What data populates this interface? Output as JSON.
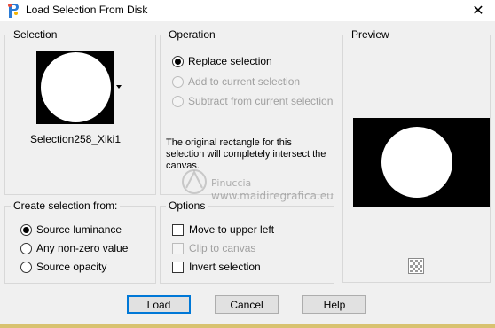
{
  "window": {
    "title": "Load Selection From Disk",
    "close_glyph": "✕"
  },
  "selection": {
    "group_label": "Selection",
    "file_name": "Selection258_Xiki1"
  },
  "operation": {
    "group_label": "Operation",
    "options": [
      {
        "label": "Replace selection",
        "selected": true,
        "enabled": true
      },
      {
        "label": "Add to current selection",
        "selected": false,
        "enabled": false
      },
      {
        "label": "Subtract from current selection",
        "selected": false,
        "enabled": false
      }
    ],
    "info": "The original rectangle for this selection will completely intersect the canvas."
  },
  "preview": {
    "group_label": "Preview"
  },
  "create_from": {
    "group_label": "Create selection from:",
    "options": [
      {
        "label": "Source luminance",
        "selected": true
      },
      {
        "label": "Any non-zero value",
        "selected": false
      },
      {
        "label": "Source opacity",
        "selected": false
      }
    ]
  },
  "options": {
    "group_label": "Options",
    "items": [
      {
        "label": "Move to upper left",
        "checked": false,
        "enabled": true
      },
      {
        "label": "Clip to canvas",
        "checked": false,
        "enabled": false
      },
      {
        "label": "Invert selection",
        "checked": false,
        "enabled": true
      }
    ]
  },
  "buttons": {
    "load": "Load",
    "cancel": "Cancel",
    "help": "Help"
  },
  "watermark": {
    "name": "Pinuccia",
    "site": "www.maidiregrafica.eu"
  },
  "colors": {
    "accent": "#0078d7",
    "strip": "#d8c270"
  },
  "icons": {
    "app": "paintshop-app-icon",
    "close": "close-icon",
    "preview_toggle": "checkerboard-icon"
  }
}
